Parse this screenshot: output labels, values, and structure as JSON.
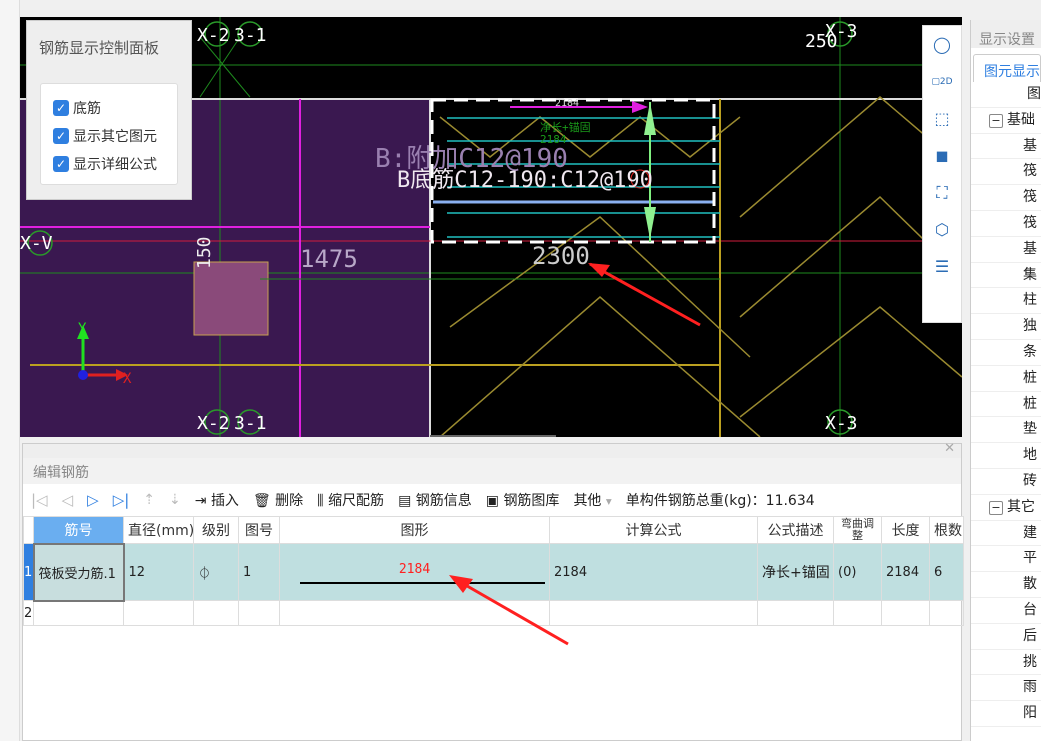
{
  "control_panel": {
    "title": "钢筋显示控制面板",
    "options": [
      {
        "label": "底筋",
        "checked": true
      },
      {
        "label": "显示其它图元",
        "checked": true
      },
      {
        "label": "显示详细公式",
        "checked": true
      }
    ]
  },
  "cad": {
    "axes": {
      "top_left_a": "X-2",
      "top_left_b": "3-1",
      "top_right": "X-3",
      "top_right_num": "250",
      "left": "X-V",
      "bot_left_a": "X-2",
      "bot_left_b": "3-1",
      "bot_right": "X-3"
    },
    "dim_top": "2184",
    "formula_desc": "净长+锚固",
    "formula_val": "2184",
    "label_extra": "B:附加C12@190",
    "label_bottom": "B底筋C12-190:C12@190",
    "dim_2300": "2300",
    "dim_1475": "1475",
    "dim_150": "150",
    "axis_y": "Y",
    "axis_x": "X"
  },
  "view_tools": [
    "orbit-icon",
    "2d-icon",
    "3d-box-icon",
    "3d-solid-icon",
    "select-frame-icon",
    "view-cube-icon",
    "list-view-icon"
  ],
  "right_panel": {
    "header": "显示设置",
    "tab": "图元显示",
    "col": "图",
    "groups": [
      {
        "label": "基础",
        "items": [
          "基",
          "筏",
          "筏",
          "筏",
          "基",
          "集",
          "柱",
          "独",
          "条",
          "桩",
          "桩",
          "垫",
          "地",
          "砖"
        ]
      },
      {
        "label": "其它",
        "items": [
          "建",
          "平",
          "散",
          "台",
          "后",
          "挑",
          "雨",
          "阳"
        ]
      }
    ]
  },
  "edit_rebar": {
    "title": "编辑钢筋",
    "toolbar": {
      "insert": "插入",
      "delete": "删除",
      "scale": "缩尺配筋",
      "info": "钢筋信息",
      "library": "钢筋图库",
      "other": "其他",
      "weight_label": "单构件钢筋总重(kg)：",
      "weight": "11.634"
    },
    "columns": [
      "筋号",
      "直径(mm)",
      "级别",
      "图号",
      "图形",
      "计算公式",
      "公式描述",
      "弯曲调整",
      "长度",
      "根数"
    ],
    "rows": [
      {
        "num": "1",
        "name": "筏板受力筋.1",
        "diameter": "12",
        "grade": "⏀",
        "shape_no": "1",
        "shape_len": "2184",
        "formula": "2184",
        "desc": "净长+锚固",
        "bend": "(0)",
        "length": "2184",
        "count": "6"
      },
      {
        "num": "2"
      }
    ]
  },
  "colors": {
    "accent": "#2f7fe0",
    "selected_row": "#bfdfe0",
    "slab": "#3a1850",
    "annotation_red": "#ff2020"
  }
}
